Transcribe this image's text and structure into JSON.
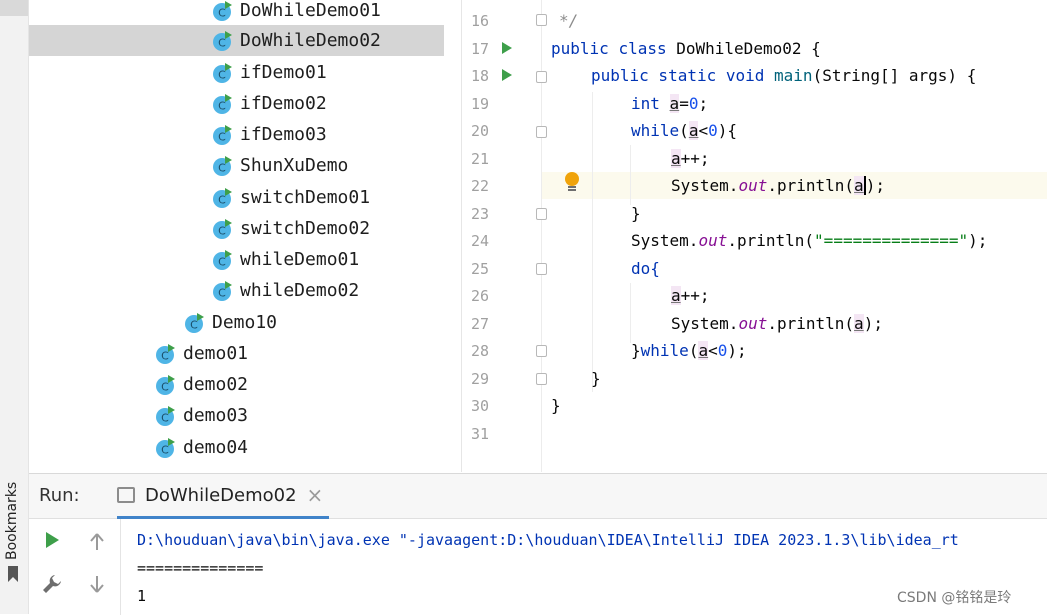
{
  "sidebar": {
    "bookmarks_label": "Bookmarks"
  },
  "tree": {
    "items": [
      {
        "label": "DoWhileDemo01"
      },
      {
        "label": "DoWhileDemo02"
      },
      {
        "label": "ifDemo01"
      },
      {
        "label": "ifDemo02"
      },
      {
        "label": "ifDemo03"
      },
      {
        "label": "ShunXuDemo"
      },
      {
        "label": "switchDemo01"
      },
      {
        "label": "switchDemo02"
      },
      {
        "label": "whileDemo01"
      },
      {
        "label": "whileDemo02"
      },
      {
        "label": "Demo10"
      },
      {
        "label": "demo01"
      },
      {
        "label": "demo02"
      },
      {
        "label": "demo03"
      },
      {
        "label": "demo04"
      }
    ]
  },
  "editor": {
    "line_numbers": [
      "16",
      "17",
      "18",
      "19",
      "20",
      "21",
      "22",
      "23",
      "24",
      "25",
      "26",
      "27",
      "28",
      "29",
      "30",
      "31"
    ],
    "comment_end": "*/",
    "class_decl": {
      "public": "public",
      "class": "class",
      "name": "DoWhileDemo02 {"
    },
    "main_decl": {
      "mods": "public static void",
      "name": "main",
      "params": "(String[] args) {"
    },
    "int_kw": "int",
    "var_a": "a",
    "assign": "=",
    "zero": "0",
    "semi": ";",
    "while_kw": "while",
    "open_paren": "(",
    "lt": "<",
    "close_brace_open": "){",
    "inc": "++;",
    "system": "System.",
    "out": "out",
    "println": ".println(",
    "close_call": ");",
    "close_brace": "}",
    "separator_string": "\"==============\"",
    "do_kw": "do{",
    "while_close": "}"
  },
  "run": {
    "title": "Run:",
    "tab_label": "DoWhileDemo02",
    "console_lines": [
      "D:\\houduan\\java\\bin\\java.exe \"-javaagent:D:\\houduan\\IDEA\\IntelliJ IDEA 2023.1.3\\lib\\idea_rt",
      "==============",
      "1"
    ]
  },
  "watermark": "CSDN @铭铭是玲"
}
